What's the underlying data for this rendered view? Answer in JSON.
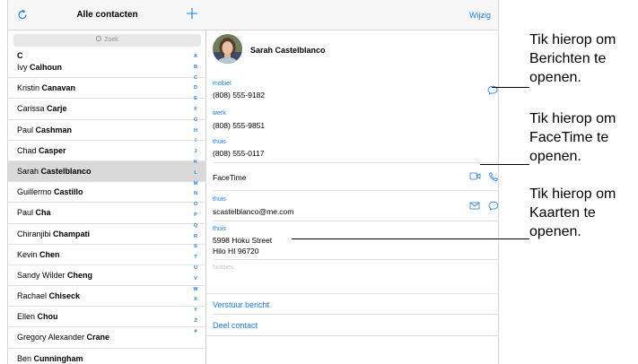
{
  "list": {
    "title": "Alle contacten",
    "search_placeholder": "Zoek",
    "section_letter": "C",
    "rows": [
      {
        "first": "Ivy ",
        "last": "Calhoun",
        "selected": false
      },
      {
        "first": "Kristin ",
        "last": "Canavan",
        "selected": false
      },
      {
        "first": "Carissa ",
        "last": "Carje",
        "selected": false
      },
      {
        "first": "Paul ",
        "last": "Cashman",
        "selected": false
      },
      {
        "first": "Chad ",
        "last": "Casper",
        "selected": false
      },
      {
        "first": "Sarah ",
        "last": "Castelblanco",
        "selected": true
      },
      {
        "first": "Guillermo ",
        "last": "Castillo",
        "selected": false
      },
      {
        "first": "Paul ",
        "last": "Cha",
        "selected": false
      },
      {
        "first": "Chiranjibi ",
        "last": "Champati",
        "selected": false
      },
      {
        "first": "Kevin ",
        "last": "Chen",
        "selected": false
      },
      {
        "first": "Sandy Wilder ",
        "last": "Cheng",
        "selected": false
      },
      {
        "first": "Rachael ",
        "last": "Chiseck",
        "selected": false
      },
      {
        "first": "Ellen ",
        "last": "Chou",
        "selected": false
      },
      {
        "first": "Gregory Alexander ",
        "last": "Crane",
        "selected": false
      },
      {
        "first": "Ben ",
        "last": "Cunningham",
        "selected": false
      }
    ],
    "index_letters": [
      "A",
      "B",
      "C",
      "D",
      "E",
      "F",
      "G",
      "H",
      "I",
      "J",
      "K",
      "L",
      "M",
      "N",
      "O",
      "P",
      "Q",
      "R",
      "S",
      "T",
      "U",
      "V",
      "W",
      "X",
      "Y",
      "Z",
      "#"
    ]
  },
  "detail": {
    "edit_label": "Wijzig",
    "name": "Sarah Castelblanco",
    "phones": [
      {
        "label": "mobiel",
        "value": "(808) 555-9182"
      },
      {
        "label": "werk",
        "value": "(808) 555-9851"
      },
      {
        "label": "thuis",
        "value": "(808) 555-0117"
      }
    ],
    "facetime_label": "FaceTime",
    "email": {
      "label": "thuis",
      "value": "scastelblanco@me.com"
    },
    "address": {
      "label": "thuis",
      "line1": "5998 Hoku Street",
      "line2": "Hilo HI 96720"
    },
    "notes_placeholder": "Notities",
    "send_message": "Verstuur bericht",
    "share_contact": "Deel contact"
  },
  "callouts": [
    {
      "lines": [
        "Tik hierop om",
        "Berichten te",
        "openen."
      ]
    },
    {
      "lines": [
        "Tik hierop om",
        "FaceTime te",
        "openen."
      ]
    },
    {
      "lines": [
        "Tik hierop om",
        "Kaarten te",
        "openen."
      ]
    }
  ],
  "colors": {
    "accent": "#1a7cf5",
    "selected_row": "#d9d9d9",
    "separator": "#e3e3e3"
  }
}
